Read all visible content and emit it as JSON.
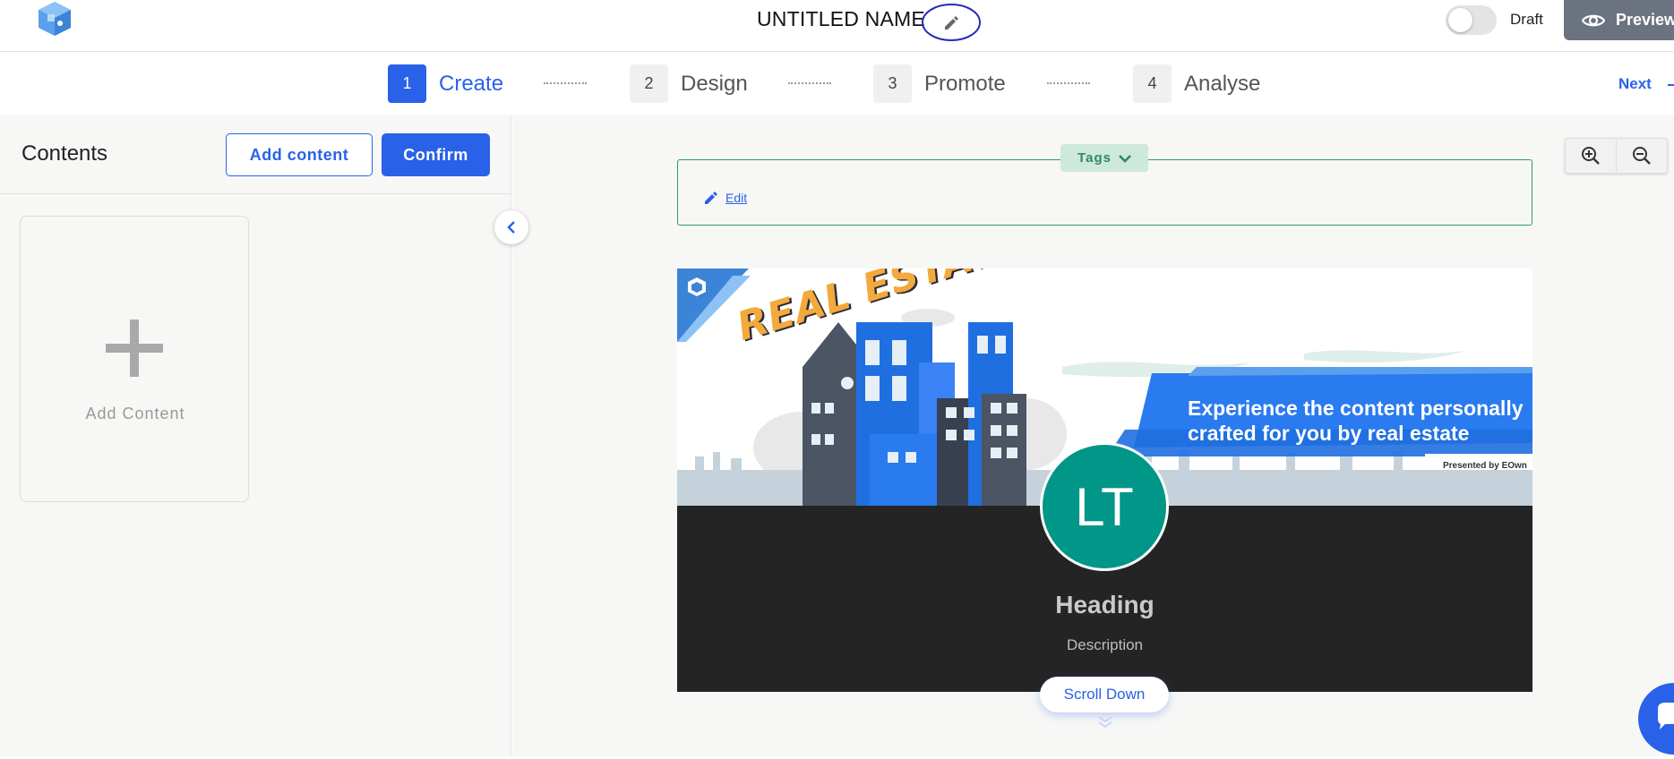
{
  "header": {
    "title": "UNTITLED NAME",
    "draft_label": "Draft",
    "preview_label": "Preview"
  },
  "steps": [
    {
      "num": "1",
      "label": "Create",
      "active": true
    },
    {
      "num": "2",
      "label": "Design"
    },
    {
      "num": "3",
      "label": "Promote"
    },
    {
      "num": "4",
      "label": "Analyse"
    }
  ],
  "next_label": "Next",
  "sidebar": {
    "title": "Contents",
    "add_content_label": "Add content",
    "confirm_label": "Confirm",
    "card_label": "Add Content"
  },
  "tags": {
    "label": "Tags",
    "edit_label": "Edit"
  },
  "preview": {
    "banner_title": "REAL ESTATE",
    "banner_text": "Experience the content personally crafted for you by real estate",
    "presented_by": "Presented by EOwn",
    "avatar_initials": "LT",
    "heading": "Heading",
    "description": "Description",
    "scroll_label": "Scroll Down"
  },
  "colors": {
    "primary": "#2962e8",
    "tags_green": "#2f9a6b",
    "avatar": "#009688",
    "dark_section": "#242424"
  }
}
